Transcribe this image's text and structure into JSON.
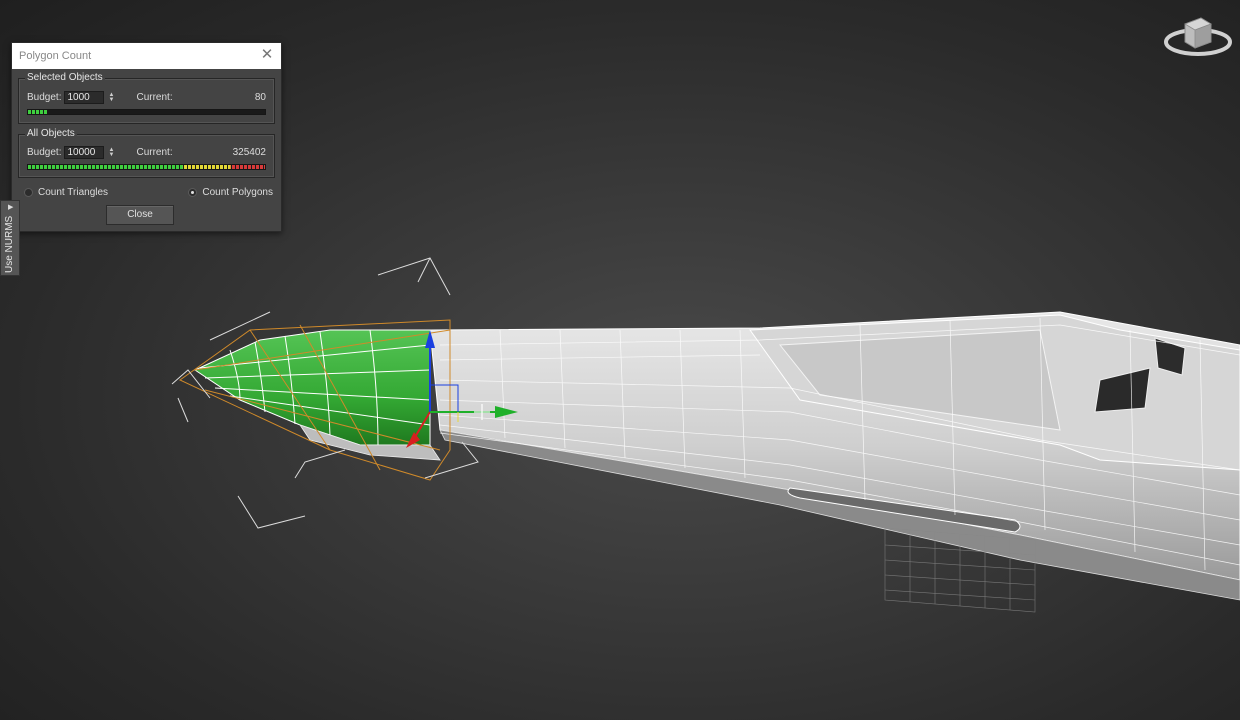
{
  "dialog": {
    "title": "Polygon Count",
    "selected_objects": {
      "label": "Selected Objects",
      "budget_label": "Budget:",
      "budget_value": "1000",
      "current_label": "Current:",
      "current_value": "80",
      "meter_fraction": 0.08
    },
    "all_objects": {
      "label": "All Objects",
      "budget_label": "Budget:",
      "budget_value": "10000",
      "current_label": "Current:",
      "current_value": "325402",
      "meter_fraction": 1.0
    },
    "radio_options": [
      {
        "label": "Count Triangles",
        "selected": false
      },
      {
        "label": "Count Polygons",
        "selected": true
      }
    ],
    "close_label": "Close"
  },
  "side_tab": {
    "label": "Use NURMS"
  },
  "colors": {
    "selection_green": "#3bb23b",
    "meter_green": "#3fcf3f",
    "meter_yellow": "#e2d836",
    "meter_red": "#d83a3a",
    "wire_orange": "#d08a2a",
    "gizmo_blue": "#1a3fe0",
    "gizmo_green": "#1fb02a",
    "gizmo_red": "#d81f1f"
  }
}
